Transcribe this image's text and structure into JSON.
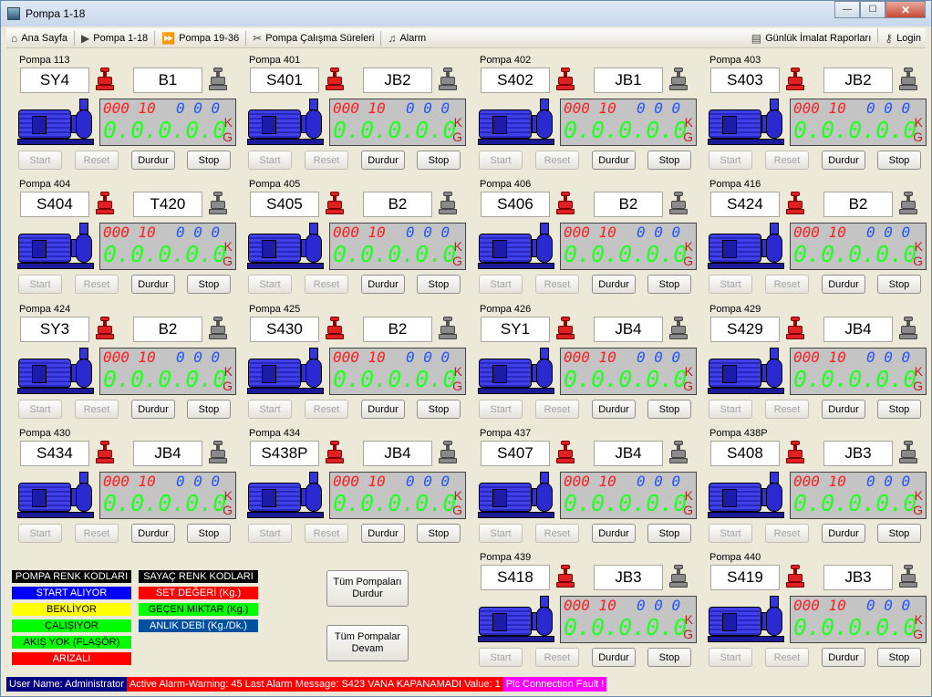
{
  "window": {
    "title": "Pompa 1-18",
    "minimize_glyph": "—",
    "maximize_glyph": "☐",
    "close_glyph": "✕"
  },
  "menu": {
    "items": [
      {
        "label": "Ana Sayfa",
        "icon": "house-icon",
        "glyph": "⌂"
      },
      {
        "label": "Pompa 1-18",
        "icon": "play-icon",
        "glyph": "▶"
      },
      {
        "label": "Pompa 19-36",
        "icon": "fast-forward-icon",
        "glyph": "⏩"
      },
      {
        "label": "Pompa Çalışma Süreleri",
        "icon": "tools-icon",
        "glyph": "✂"
      },
      {
        "label": "Alarm",
        "icon": "bell-icon",
        "glyph": "♫"
      }
    ],
    "right_items": [
      {
        "label": "Günlük İmalat Raporları",
        "icon": "report-icon",
        "glyph": "▤"
      },
      {
        "label": "Login",
        "icon": "key-icon",
        "glyph": "⚷"
      }
    ]
  },
  "lcd_default": {
    "set": "000 10",
    "rate": "0 0 0",
    "amount": "0.0.0.0.0",
    "unit_k": "K",
    "unit_g": "G"
  },
  "buttons": {
    "start": "Start",
    "reset": "Reset",
    "durdur": "Durdur",
    "stop": "Stop"
  },
  "pumps": [
    {
      "name": "Pompa 113",
      "code": "SY4",
      "tank": "B1"
    },
    {
      "name": "Pompa 401",
      "code": "S401",
      "tank": "JB2"
    },
    {
      "name": "Pompa 402",
      "code": "S402",
      "tank": "JB1"
    },
    {
      "name": "Pompa 403",
      "code": "S403",
      "tank": "JB2"
    },
    {
      "name": "Pompa 404",
      "code": "S404",
      "tank": "T420"
    },
    {
      "name": "Pompa 405",
      "code": "S405",
      "tank": "B2"
    },
    {
      "name": "Pompa 406",
      "code": "S406",
      "tank": "B2"
    },
    {
      "name": "Pompa 416",
      "code": "S424",
      "tank": "B2"
    },
    {
      "name": "Pompa 424",
      "code": "SY3",
      "tank": "B2"
    },
    {
      "name": "Pompa 425",
      "code": "S430",
      "tank": "B2"
    },
    {
      "name": "Pompa 426",
      "code": "SY1",
      "tank": "JB4"
    },
    {
      "name": "Pompa 429",
      "code": "S429",
      "tank": "JB4"
    },
    {
      "name": "Pompa 430",
      "code": "S434",
      "tank": "JB4"
    },
    {
      "name": "Pompa 434",
      "code": "S438P",
      "tank": "JB4"
    },
    {
      "name": "Pompa 437",
      "code": "S407",
      "tank": "JB4"
    },
    {
      "name": "Pompa 438P",
      "code": "S408",
      "tank": "JB3"
    },
    {
      "name": "Pompa 439",
      "code": "S418",
      "tank": "JB3"
    },
    {
      "name": "Pompa 440",
      "code": "S419",
      "tank": "JB3"
    }
  ],
  "legend_pump": {
    "header": "POMPA RENK KODLARI",
    "items": [
      {
        "label": "START ALIYOR",
        "bg": "#0000ff",
        "fg": "#ffffff"
      },
      {
        "label": "BEKLİYOR",
        "bg": "#ffff00",
        "fg": "#000000"
      },
      {
        "label": "ÇALIŞIYOR",
        "bg": "#00ff00",
        "fg": "#000000"
      },
      {
        "label": "AKIŞ YOK (FLAŞÖR)",
        "bg": "#00ff00",
        "fg": "#000000"
      },
      {
        "label": "ARIZALI",
        "bg": "#ff0000",
        "fg": "#ffffff"
      }
    ]
  },
  "legend_counter": {
    "header": "SAYAÇ RENK KODLARI",
    "items": [
      {
        "label": "SET DEĞERİ (Kg.)",
        "bg": "#ff0000",
        "fg": "#ffffff"
      },
      {
        "label": "GEÇEN MİKTAR (Kg.)",
        "bg": "#00ff00",
        "fg": "#000000"
      },
      {
        "label": "ANLIK DEBİ (Kg./Dk.)",
        "bg": "#0050a0",
        "fg": "#ffffff"
      }
    ]
  },
  "actions": {
    "stop_all": "Tüm Pompaları Durdur",
    "resume_all": "Tüm Pompalar Devam"
  },
  "status": {
    "user": "User Name: Administrator",
    "alarm": "Active Alarm-Warning: 45  Last Alarm Message: S423 VANA KAPANAMADI Value: 1",
    "plc": "Plc Connection Fault !",
    "colors": {
      "user_bg": "#000080",
      "alarm_bg": "#ff0000",
      "plc_bg": "#ff00ff"
    }
  }
}
